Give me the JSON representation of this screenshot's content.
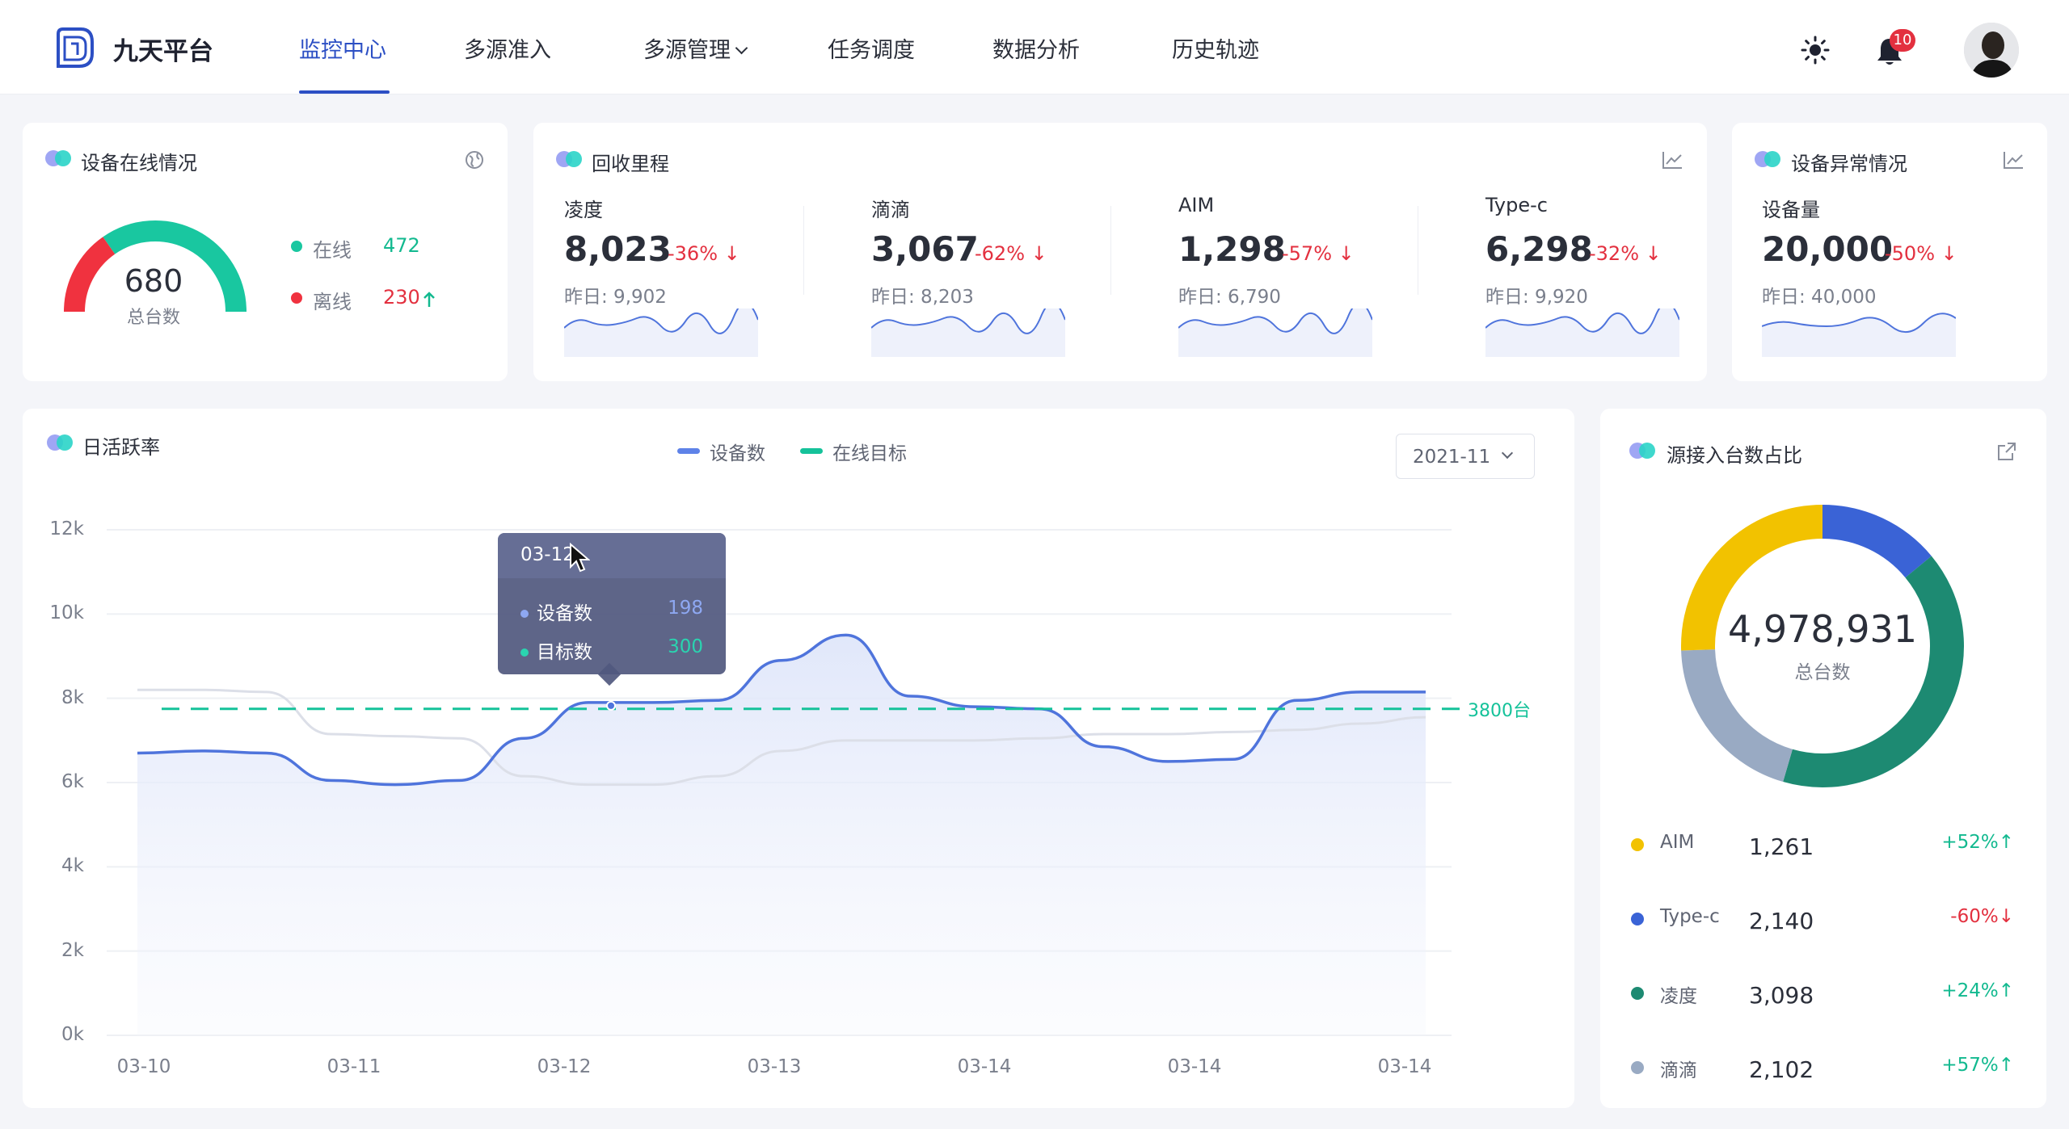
{
  "app": {
    "brand": "九天平台"
  },
  "nav": {
    "items": [
      "监控中心",
      "多源准入",
      "多源管理",
      "任务调度",
      "数据分析",
      "历史轨迹"
    ],
    "active": "监控中心"
  },
  "header": {
    "notification_count": "10",
    "icons": [
      "sun-icon",
      "bell-icon",
      "avatar"
    ]
  },
  "online_card": {
    "title": "设备在线情况",
    "total_value": "680",
    "total_label": "总台数",
    "online_label": "在线",
    "online_value": "472",
    "offline_label": "离线",
    "offline_value": "230",
    "online_fraction": 0.694
  },
  "recycle_card": {
    "title": "回收里程",
    "items": [
      {
        "name": "凌度",
        "value": "8,023",
        "change": "-36%",
        "yesterday": "昨日: 9,902"
      },
      {
        "name": "滴滴",
        "value": "3,067",
        "change": "-62%",
        "yesterday": "昨日: 8,203"
      },
      {
        "name": "AIM",
        "value": "1,298",
        "change": "-57%",
        "yesterday": "昨日: 6,790"
      },
      {
        "name": "Type-c",
        "value": "6,298",
        "change": "-32%",
        "yesterday": "昨日: 9,920"
      }
    ]
  },
  "anomaly_card": {
    "title": "设备异常情况",
    "name": "设备量",
    "value": "20,000",
    "change": "-50%",
    "yesterday": "昨日: 40,000"
  },
  "daily_card": {
    "title": "日活跃率",
    "legend": [
      "设备数",
      "在线目标"
    ],
    "select_value": "2021-11",
    "target_label": "3800台",
    "tooltip": {
      "date": "03-12",
      "rows": [
        {
          "name": "设备数",
          "value": "198"
        },
        {
          "name": "目标数",
          "value": "300"
        }
      ]
    }
  },
  "chart_data": {
    "type": "line",
    "x": [
      "03-10",
      "03-11",
      "03-12",
      "03-13",
      "03-14",
      "03-14",
      "03-14"
    ],
    "y_ticks": [
      "12k",
      "10k",
      "8k",
      "6k",
      "4k",
      "2k",
      "0k"
    ],
    "ylim": [
      0,
      12000
    ],
    "series": [
      {
        "name": "设备数",
        "color": "#4f74dc",
        "values": [
          6700,
          6750,
          6700,
          6050,
          5950,
          6050,
          7050,
          7900,
          7900,
          7950,
          8900,
          9500,
          8050,
          7800,
          7750,
          6850,
          6500,
          6550,
          7950,
          8150,
          8150
        ]
      },
      {
        "name": "comparison",
        "color": "#dcdfe8",
        "values": [
          8200,
          8200,
          8150,
          7150,
          7100,
          7050,
          6150,
          5950,
          5950,
          6150,
          6750,
          7000,
          7000,
          7000,
          7050,
          7150,
          7150,
          7200,
          7250,
          7400,
          7550
        ]
      }
    ],
    "target": {
      "name": "在线目标",
      "value": 7750,
      "color": "#15c29a"
    }
  },
  "source_card": {
    "title": "源接入台数占比",
    "total_value": "4,978,931",
    "total_label": "总台数",
    "items": [
      {
        "name": "AIM",
        "value": "1,261",
        "change": "+52%",
        "color": "#f2c200"
      },
      {
        "name": "Type-c",
        "value": "2,140",
        "change": "-60%",
        "color": "#3a63d6"
      },
      {
        "name": "凌度",
        "value": "3,098",
        "change": "+24%",
        "color": "#1d8a72"
      },
      {
        "name": "滴滴",
        "value": "2,102",
        "change": "+57%",
        "color": "#99aac3"
      }
    ],
    "donut_fractions": [
      0.255,
      0.14,
      0.405,
      0.2
    ]
  }
}
